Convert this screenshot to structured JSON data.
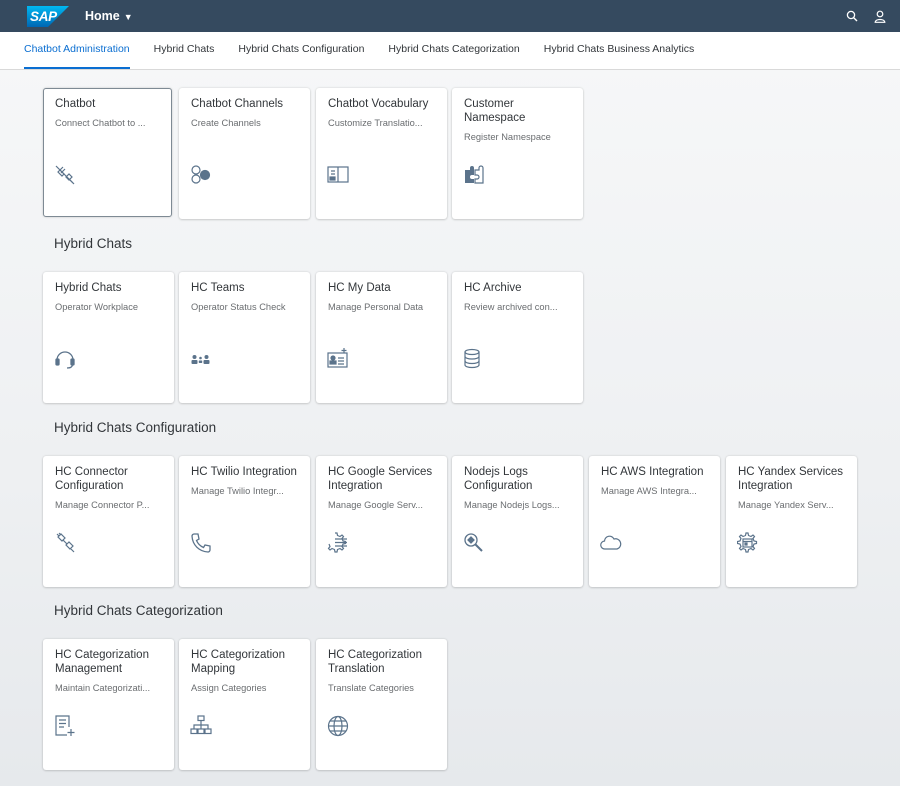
{
  "shell": {
    "logo_text": "SAP",
    "home_label": "Home"
  },
  "tabs": [
    {
      "label": "Chatbot Administration",
      "active": true
    },
    {
      "label": "Hybrid Chats",
      "active": false
    },
    {
      "label": "Hybrid Chats Configuration",
      "active": false
    },
    {
      "label": "Hybrid Chats Categorization",
      "active": false
    },
    {
      "label": "Hybrid Chats Business Analytics",
      "active": false
    }
  ],
  "sections": [
    {
      "title": "",
      "tiles": [
        {
          "title": "Chatbot",
          "subtitle": "Connect Chatbot to ...",
          "icon": "disconnected-plug-icon"
        },
        {
          "title": "Chatbot Channels",
          "subtitle": "Create Channels",
          "icon": "channels-icon"
        },
        {
          "title": "Chatbot Vocabulary",
          "subtitle": "Customize Translatio...",
          "icon": "book-icon"
        },
        {
          "title": "Customer Namespace",
          "subtitle": "Register Namespace",
          "icon": "puzzle-icon"
        }
      ]
    },
    {
      "title": "Hybrid Chats",
      "tiles": [
        {
          "title": "Hybrid Chats",
          "subtitle": "Operator Workplace",
          "icon": "headset-icon"
        },
        {
          "title": "HC Teams",
          "subtitle": "Operator Status Check",
          "icon": "team-icon"
        },
        {
          "title": "HC My Data",
          "subtitle": "Manage Personal Data",
          "icon": "personal-data-icon"
        },
        {
          "title": "HC Archive",
          "subtitle": "Review archived con...",
          "icon": "database-icon"
        }
      ]
    },
    {
      "title": "Hybrid Chats Configuration",
      "tiles": [
        {
          "title": "HC Connector Configuration",
          "subtitle": "Manage Connector P...",
          "icon": "connector-icon"
        },
        {
          "title": "HC Twilio Integration",
          "subtitle": "Manage Twilio Integr...",
          "icon": "phone-icon"
        },
        {
          "title": "HC Google Services Integration",
          "subtitle": "Manage Google Serv...",
          "icon": "settings-list-icon"
        },
        {
          "title": "Nodejs Logs Configuration",
          "subtitle": "Manage Nodejs Logs...",
          "icon": "search-logs-icon"
        },
        {
          "title": "HC AWS Integration",
          "subtitle": "Manage AWS Integra...",
          "icon": "cloud-icon"
        },
        {
          "title": "HC Yandex Services Integration",
          "subtitle": "Manage Yandex Serv...",
          "icon": "gear-calendar-icon"
        }
      ]
    },
    {
      "title": "Hybrid Chats Categorization",
      "tiles": [
        {
          "title": "HC Categorization Management",
          "subtitle": "Maintain Categorizati...",
          "icon": "add-document-icon"
        },
        {
          "title": "HC Categorization Mapping",
          "subtitle": "Assign Categories",
          "icon": "hierarchy-icon"
        },
        {
          "title": "HC Categorization Translation",
          "subtitle": "Translate Categories",
          "icon": "globe-icon"
        }
      ]
    }
  ]
}
